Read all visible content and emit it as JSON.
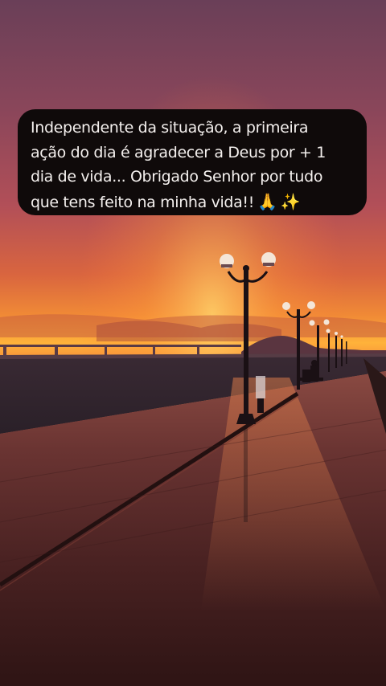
{
  "post": {
    "caption_lines": [
      "Independente da situação, a primeira",
      "ação do dia é agradecer a Deus por + 1",
      "dia de vida... Obrigado Senhor por tudo",
      "que tens feito na minha vida!!"
    ],
    "emojis": {
      "pray": "🙏",
      "sparkles": "✨"
    }
  },
  "background": {
    "scene": "sunset seaside promenade with street lamps",
    "colors": {
      "sky_top": "#6a3f58",
      "sky_mid": "#c55a56",
      "horizon": "#ffb23a",
      "ground": "#3e1c1c"
    }
  }
}
